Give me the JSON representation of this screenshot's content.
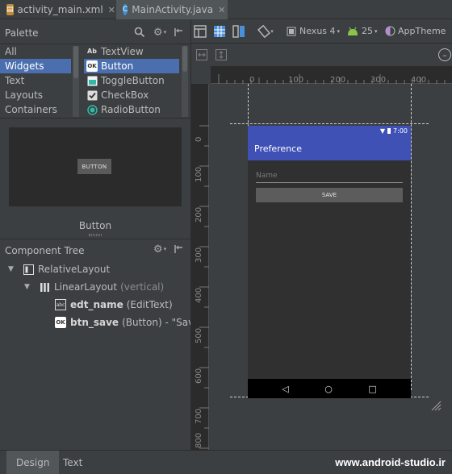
{
  "tabs": [
    {
      "label": "activity_main.xml",
      "icon": "layout-xml-icon",
      "active": false
    },
    {
      "label": "MainActivity.java",
      "icon": "java-class-icon",
      "active": true
    }
  ],
  "palette": {
    "title": "Palette",
    "categories": [
      "All",
      "Widgets",
      "Text",
      "Layouts",
      "Containers"
    ],
    "selected_category": "Widgets",
    "items": [
      {
        "label": "TextView",
        "icon": "Ab"
      },
      {
        "label": "Button",
        "icon": "OK"
      },
      {
        "label": "ToggleButton",
        "icon": "toggle-icon"
      },
      {
        "label": "CheckBox",
        "icon": "checkbox-icon"
      },
      {
        "label": "RadioButton",
        "icon": "radio-icon"
      }
    ],
    "selected_item": "Button"
  },
  "preview": {
    "button_text": "BUTTON",
    "label": "Button"
  },
  "component_tree": {
    "title": "Component Tree",
    "nodes": [
      {
        "name": "RelativeLayout",
        "sub": ""
      },
      {
        "name": "LinearLayout",
        "sub": "(vertical)"
      },
      {
        "id": "edt_name",
        "sub": "(EditText)",
        "icon": "abc"
      },
      {
        "id": "btn_save",
        "sub": "(Button) - \"Save\"",
        "icon": "OK"
      }
    ]
  },
  "design_toolbar": {
    "device": "Nexus 4",
    "api": "25",
    "theme": "AppTheme"
  },
  "ruler": {
    "h_ticks": [
      "0",
      "100",
      "200",
      "300",
      "400"
    ],
    "v_ticks": [
      "0",
      "100",
      "200",
      "300",
      "400",
      "500",
      "600",
      "700",
      "800"
    ]
  },
  "device_preview": {
    "status_time": "7:00",
    "app_title": "Preference",
    "edit_hint": "Name",
    "button_text": "SAVE"
  },
  "bottom_tabs": [
    "Design",
    "Text"
  ],
  "active_bottom_tab": "Design",
  "watermark": "www.android-studio.ir",
  "colors": {
    "primary": "#3f51b5",
    "selection": "#4b6eaf",
    "background": "#3c3f41"
  }
}
